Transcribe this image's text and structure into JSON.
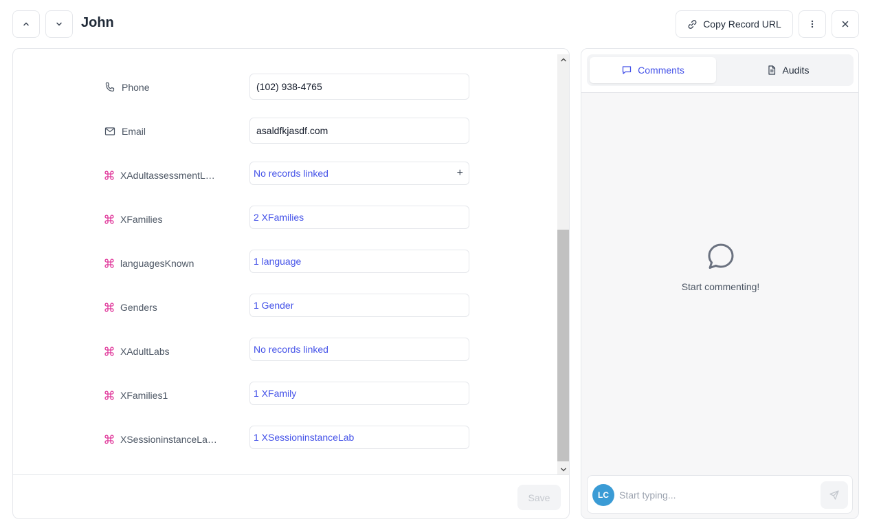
{
  "header": {
    "title": "John",
    "copy_url_label": "Copy Record URL"
  },
  "fields": [
    {
      "label": "Phone",
      "value": "(102) 938-4765",
      "icon": "phone-icon",
      "type": "text"
    },
    {
      "label": "Email",
      "value": "asaldfkjasdf.com",
      "icon": "mail-icon",
      "type": "text"
    },
    {
      "label": "XAdultassessmentL…",
      "value": "No records linked",
      "icon": "link-icon",
      "type": "link",
      "addable": true
    },
    {
      "label": "XFamilies",
      "value": "2 XFamilies",
      "icon": "link-icon",
      "type": "link"
    },
    {
      "label": "languagesKnown",
      "value": "1 language",
      "icon": "link-icon",
      "type": "link"
    },
    {
      "label": "Genders",
      "value": "1 Gender",
      "icon": "link-icon",
      "type": "link"
    },
    {
      "label": "XAdultLabs",
      "value": "No records linked",
      "icon": "link-icon",
      "type": "link"
    },
    {
      "label": "XFamilies1",
      "value": "1 XFamily",
      "icon": "link-icon",
      "type": "link"
    },
    {
      "label": "XSessioninstanceLa…",
      "value": "1 XSessioninstanceLab",
      "icon": "link-icon",
      "type": "link"
    }
  ],
  "footer": {
    "save_label": "Save"
  },
  "sidebar": {
    "tabs": [
      {
        "label": "Comments",
        "active": true
      },
      {
        "label": "Audits",
        "active": false
      }
    ],
    "empty_text": "Start commenting!",
    "avatar_initials": "LC",
    "input_placeholder": "Start typing..."
  },
  "colors": {
    "accent": "#4351e8",
    "link_icon": "#e0379a",
    "avatar": "#3a9bd5"
  }
}
